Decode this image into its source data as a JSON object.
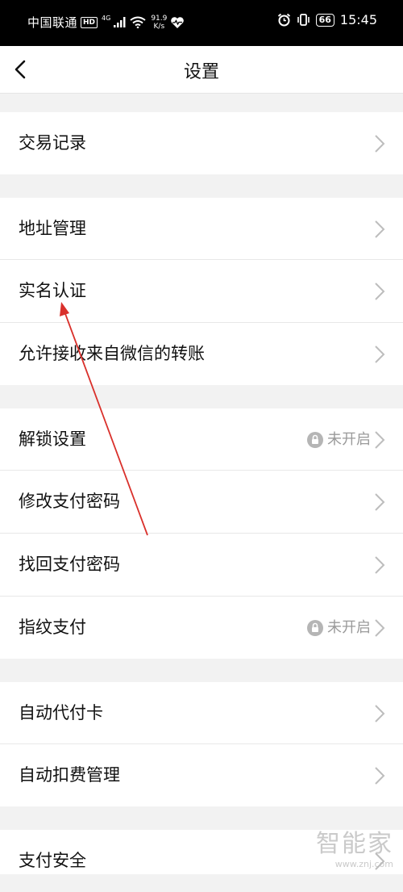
{
  "status_bar": {
    "carrier": "中国联通",
    "hd": "HD",
    "network": "4G",
    "speed_value": "91.9",
    "speed_unit": "K/s",
    "battery": "66",
    "time": "15:45"
  },
  "header": {
    "title": "设置"
  },
  "groups": [
    {
      "items": [
        {
          "label": "交易记录"
        }
      ]
    },
    {
      "items": [
        {
          "label": "地址管理"
        },
        {
          "label": "实名认证"
        },
        {
          "label": "允许接收来自微信的转账"
        }
      ]
    },
    {
      "items": [
        {
          "label": "解锁设置",
          "status": "未开启"
        },
        {
          "label": "修改支付密码"
        },
        {
          "label": "找回支付密码"
        },
        {
          "label": "指纹支付",
          "status": "未开启"
        }
      ]
    },
    {
      "items": [
        {
          "label": "自动代付卡"
        },
        {
          "label": "自动扣费管理"
        }
      ]
    },
    {
      "items": [
        {
          "label": "支付安全"
        }
      ]
    }
  ],
  "watermark": {
    "brand": "智能家",
    "url": "www.znj.com"
  },
  "colors": {
    "annotation_arrow": "#d9302b",
    "status_gray": "#9a9a9a"
  }
}
